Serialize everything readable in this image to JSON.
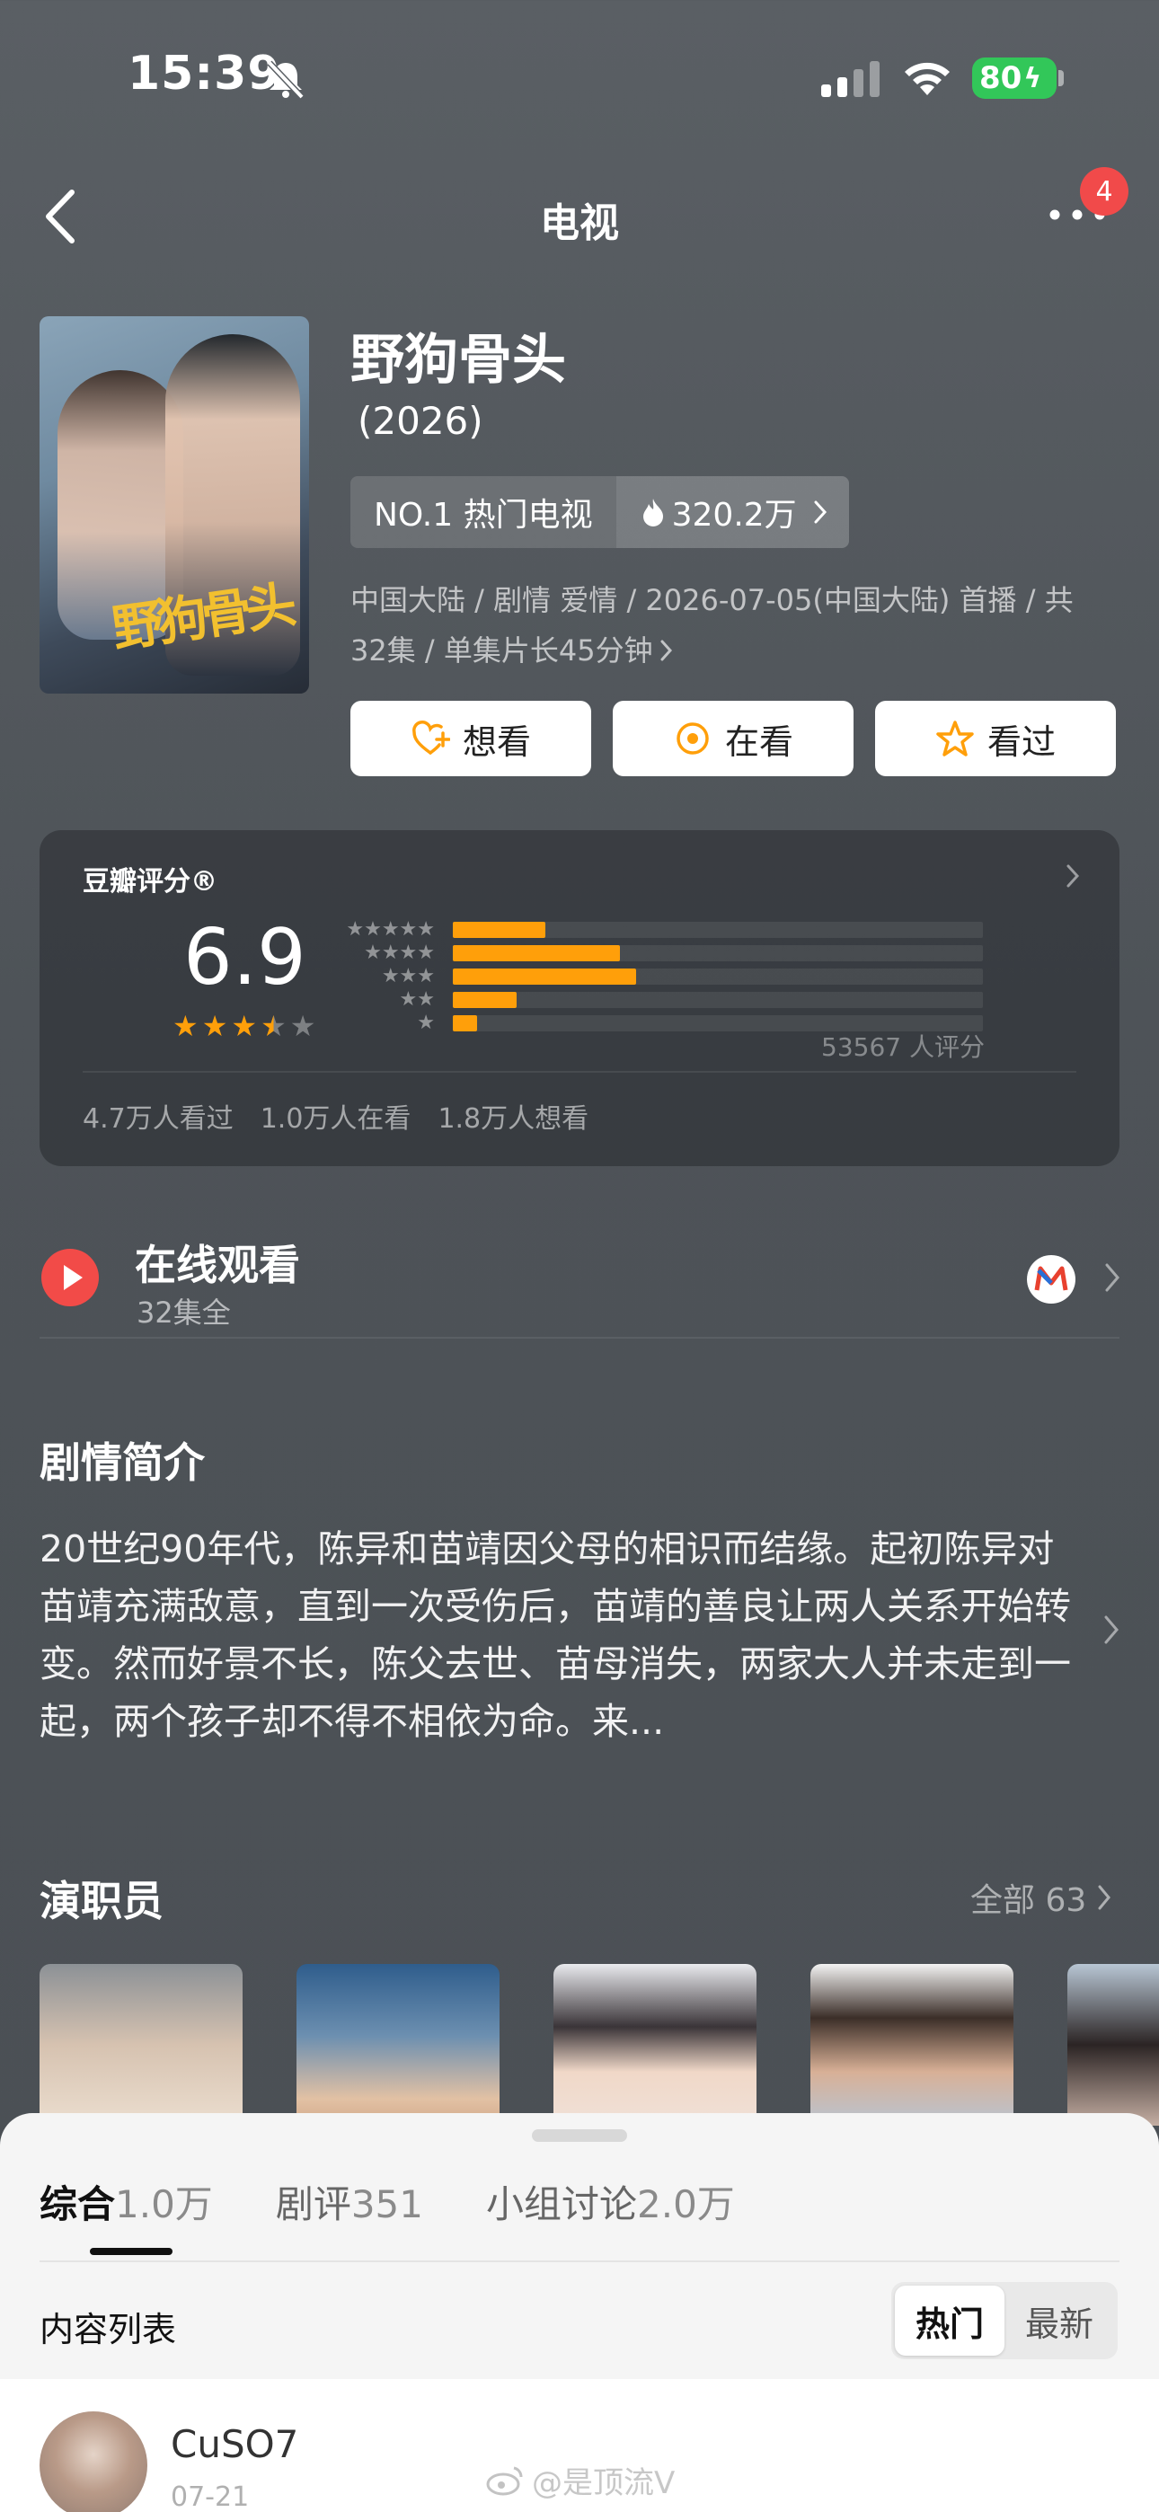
{
  "status_bar": {
    "time": "15:39",
    "battery": "80"
  },
  "nav": {
    "title": "电视",
    "badge": "4"
  },
  "movie": {
    "title": "野狗骨头",
    "year": "(2026)",
    "rank_label": "NO.1 热门电视",
    "heat": "320.2万",
    "meta_line1": "中国大陆 / 剧情 爱情 / 2026-07-05(中国大陆) 首播 / 共",
    "meta_line2": "32集 / 单集片长45分钟",
    "poster_art_text": "野狗骨头"
  },
  "actions": {
    "want": "想看",
    "watching": "在看",
    "watched": "看过"
  },
  "rating": {
    "label": "豆瓣评分®",
    "score": "6.9",
    "stars": 3.5,
    "star_rows": [
      "★★★★★",
      "★★★★",
      "★★★",
      "★★",
      "★"
    ],
    "distribution": [
      0.175,
      0.315,
      0.345,
      0.12,
      0.045
    ],
    "count": "53567 人评分",
    "watched": "4.7万人看过",
    "watching": "1.0万人在看",
    "wish": "1.8万人想看"
  },
  "online": {
    "title": "在线观看",
    "subtitle": "32集全"
  },
  "synopsis": {
    "title": "剧情简介",
    "text": "20世纪90年代，陈异和苗靖因父母的相识而结缘。起初陈异对苗靖充满敌意，直到一次受伤后，苗靖的善良让两人关系开始转变。然而好景不长，陈父去世、苗母消失，两家大人并未走到一起，两个孩子却不得不相依为命。来..."
  },
  "cast": {
    "title": "演职员",
    "all_label": "全部 63"
  },
  "sheet": {
    "tabs": [
      {
        "name": "综合",
        "count": "1.0万"
      },
      {
        "name": "剧评",
        "count": "351"
      },
      {
        "name": "小组讨论",
        "count": "2.0万"
      }
    ],
    "list_label": "内容列表",
    "sort_hot": "热门",
    "sort_new": "最新",
    "first_user": {
      "name": "CuSO7",
      "date": "07-21"
    }
  },
  "watermark": "@是顶流V",
  "colors": {
    "accent": "#ff9f0a",
    "play": "#f24b48",
    "badge": "#f14a4a",
    "battery": "#32c759"
  }
}
